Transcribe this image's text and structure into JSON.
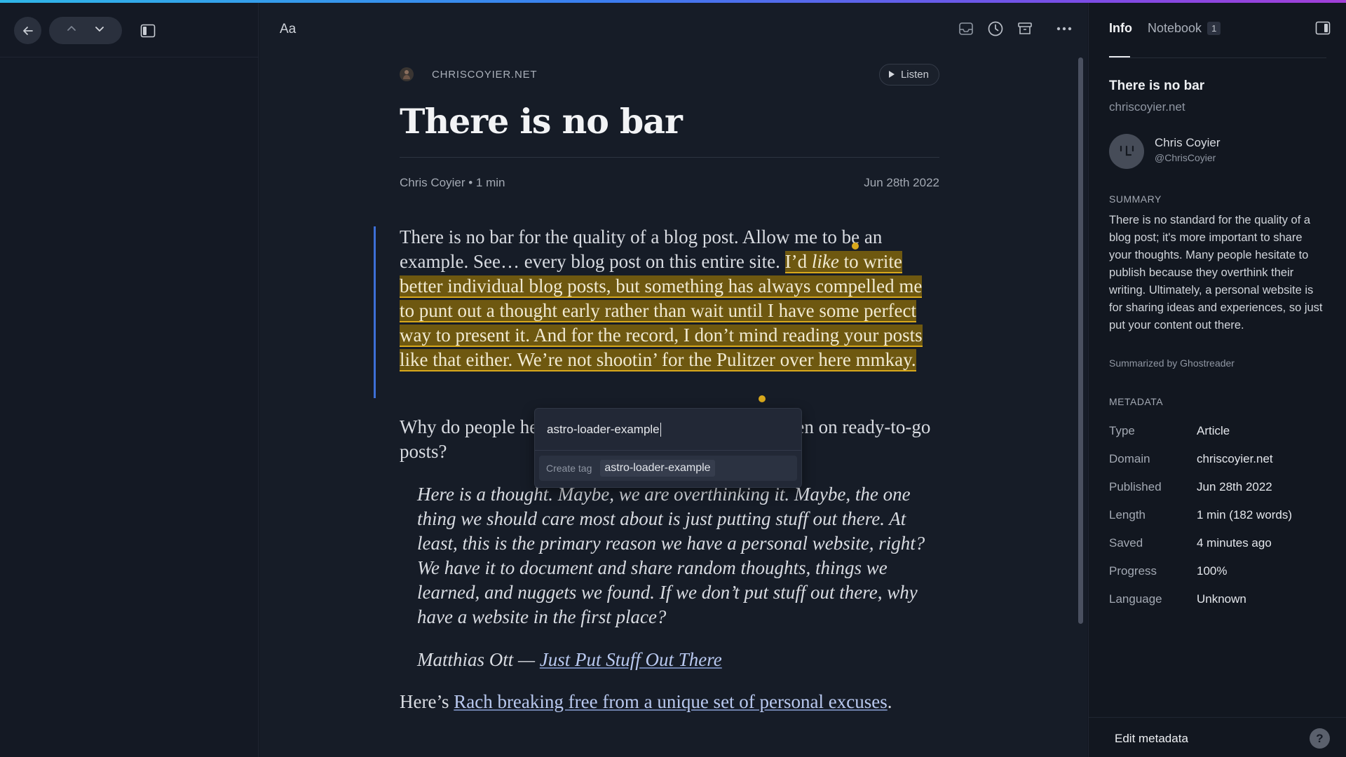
{
  "toolbar": {
    "font_label": "Aa"
  },
  "article": {
    "source": "CHRISCOYIER.NET",
    "listen_label": "Listen",
    "title": "There is no bar",
    "author_readtime": "Chris Coyier • 1 min",
    "date": "Jun 28th 2022",
    "p1_plain": "There is no bar for the quality of a blog post. Allow me to be an example. See… every blog post on this entire site. ",
    "p1_hl_a": "I’d ",
    "p1_hl_em": "like",
    "p1_hl_b": " to write better individual blog posts, but something has always compelled me to punt out a thought early rather than wait until I have some perfect way to present it. And for the record, I don’t mind reading your posts like that either. We’re not shootin’ for the Pulitzer over here mmkay.",
    "p2": "Why do people hesitate to hit that publish button, even on ready-to-go posts?",
    "blockquote": "Here is a thought. Maybe, we are overthinking it. Maybe, the one thing we should care most about is just putting stuff out there. At least, this is the primary reason we have a personal website, right? We have it to document and share random thoughts, things we learned, and nuggets we found. If we don’t put stuff out there, why have a website in the first place?",
    "attribution_prefix": "Matthias Ott — ",
    "attribution_link": "Just Put Stuff Out There",
    "p3_prefix": "Here’s ",
    "p3_link": "Rach breaking free from a unique set of personal excuses",
    "p3_suffix": "."
  },
  "tag_popover": {
    "input_value": "astro-loader-example",
    "create_label": "Create tag",
    "create_value": "astro-loader-example"
  },
  "panel": {
    "tab_info": "Info",
    "tab_notebook": "Notebook",
    "notebook_count": "1",
    "title": "There is no bar",
    "domain": "chriscoyier.net",
    "author_name": "Chris Coyier",
    "author_handle": "@ChrisCoyier",
    "summary_heading": "SUMMARY",
    "summary": "There is no standard for the quality of a blog post; it's more important to share your thoughts. Many people hesitate to publish because they overthink their writing. Ultimately, a personal website is for sharing ideas and experiences, so just put your content out there.",
    "summarized_by": "Summarized by Ghostreader",
    "metadata_heading": "METADATA",
    "metadata": [
      {
        "key": "Type",
        "value": "Article"
      },
      {
        "key": "Domain",
        "value": "chriscoyier.net"
      },
      {
        "key": "Published",
        "value": "Jun 28th 2022"
      },
      {
        "key": "Length",
        "value": "1 min (182 words)"
      },
      {
        "key": "Saved",
        "value": "4 minutes ago"
      },
      {
        "key": "Progress",
        "value": "100%"
      },
      {
        "key": "Language",
        "value": "Unknown"
      }
    ],
    "edit_metadata": "Edit metadata",
    "help": "?"
  },
  "colors": {
    "highlight_bg": "#6e5810",
    "highlight_border": "#d8a81c",
    "accent_bar": "#3d6fd6",
    "link": "#b9c9f0"
  },
  "icons": [
    "back-arrow-icon",
    "chevron-up-icon",
    "chevron-down-icon",
    "sidebar-toggle-icon",
    "inbox-icon",
    "clock-icon",
    "archive-icon",
    "more-icon",
    "play-icon",
    "panel-toggle-icon"
  ]
}
